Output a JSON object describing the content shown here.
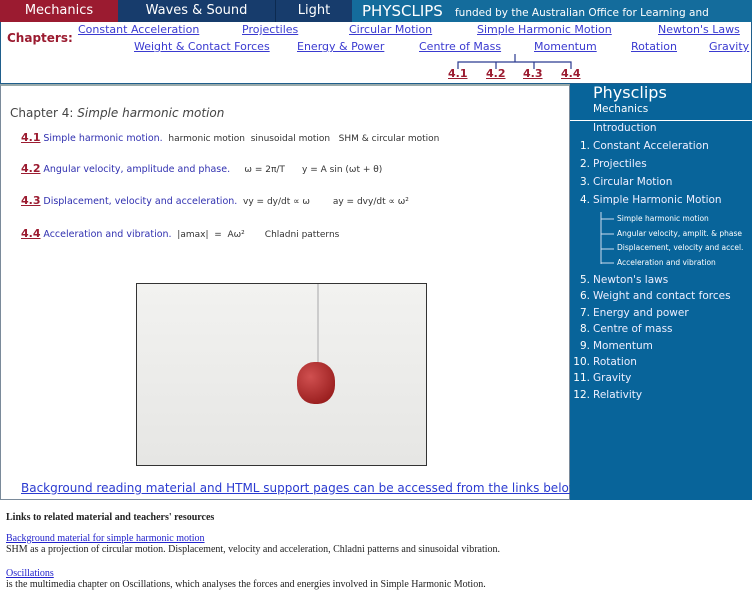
{
  "topnav": {
    "tabs": [
      "Mechanics",
      "Waves & Sound",
      "Light"
    ],
    "brand": "PHYSCLIPS",
    "funded": "funded by the Australian Office for Learning and Teaching"
  },
  "chapters": {
    "label": "Chapters:",
    "row1": [
      "Constant Acceleration",
      "Projectiles",
      "Circular Motion",
      "Simple Harmonic Motion",
      "Newton's Laws"
    ],
    "row2": [
      "Weight & Contact Forces",
      "Energy & Power",
      "Centre of Mass",
      "Momentum",
      "Rotation",
      "Gravity"
    ],
    "sections": [
      "4.1",
      "4.2",
      "4.3",
      "4.4"
    ]
  },
  "main": {
    "chapter_prefix": "Chapter 4: ",
    "chapter_title": "Simple harmonic motion",
    "rows": [
      {
        "num": "4.1",
        "title": "Simple harmonic motion.",
        "extra": "harmonic motion  sinusoidal motion   SHM & circular motion"
      },
      {
        "num": "4.2",
        "title": "Angular velocity, amplitude and phase.",
        "extra": "ω = 2π/T      y = A sin (ωt + θ)"
      },
      {
        "num": "4.3",
        "title": "Displacement, velocity and acceleration.",
        "extra": "vy = dy/dt ∝ ω        ay = dvy/dt ∝ ω²"
      },
      {
        "num": "4.4",
        "title": "Acceleration and vibration.",
        "extra": "|amax|  =  Aω²       Chladni patterns"
      }
    ],
    "background_link": "Background reading material and HTML support pages can be accessed from the links below"
  },
  "sidebar": {
    "title": "Physclips",
    "subtitle": "Mechanics",
    "intro": "Introduction",
    "items": [
      {
        "n": "1.",
        "l": "Constant Acceleration"
      },
      {
        "n": "2.",
        "l": "Projectiles"
      },
      {
        "n": "3.",
        "l": "Circular Motion"
      },
      {
        "n": "4.",
        "l": "Simple Harmonic Motion"
      }
    ],
    "subitems": [
      "Simple harmonic motion",
      "Angular velocity, amplit. & phase",
      "Displacement, velocity and accel.",
      "Acceleration and vibration"
    ],
    "items2": [
      {
        "n": "5.",
        "l": "Newton's laws"
      },
      {
        "n": "6.",
        "l": "Weight and contact forces"
      },
      {
        "n": "7.",
        "l": "Energy and power"
      },
      {
        "n": "8.",
        "l": "Centre of mass"
      },
      {
        "n": "9.",
        "l": "Momentum"
      },
      {
        "n": "10.",
        "l": "Rotation"
      },
      {
        "n": "11.",
        "l": "Gravity"
      },
      {
        "n": "12.",
        "l": "Relativity"
      }
    ]
  },
  "footer": {
    "heading": "Links to related material and teachers' resources",
    "links": [
      {
        "label": "Background material for simple harmonic motion",
        "desc": "SHM as a projection of circular motion. Displacement, velocity and acceleration, Chladni patterns and sinusoidal vibration."
      },
      {
        "label": "Oscillations",
        "desc": "is the multimedia chapter on Oscillations, which analyses the forces and energies involved in Simple Harmonic Motion."
      }
    ]
  }
}
